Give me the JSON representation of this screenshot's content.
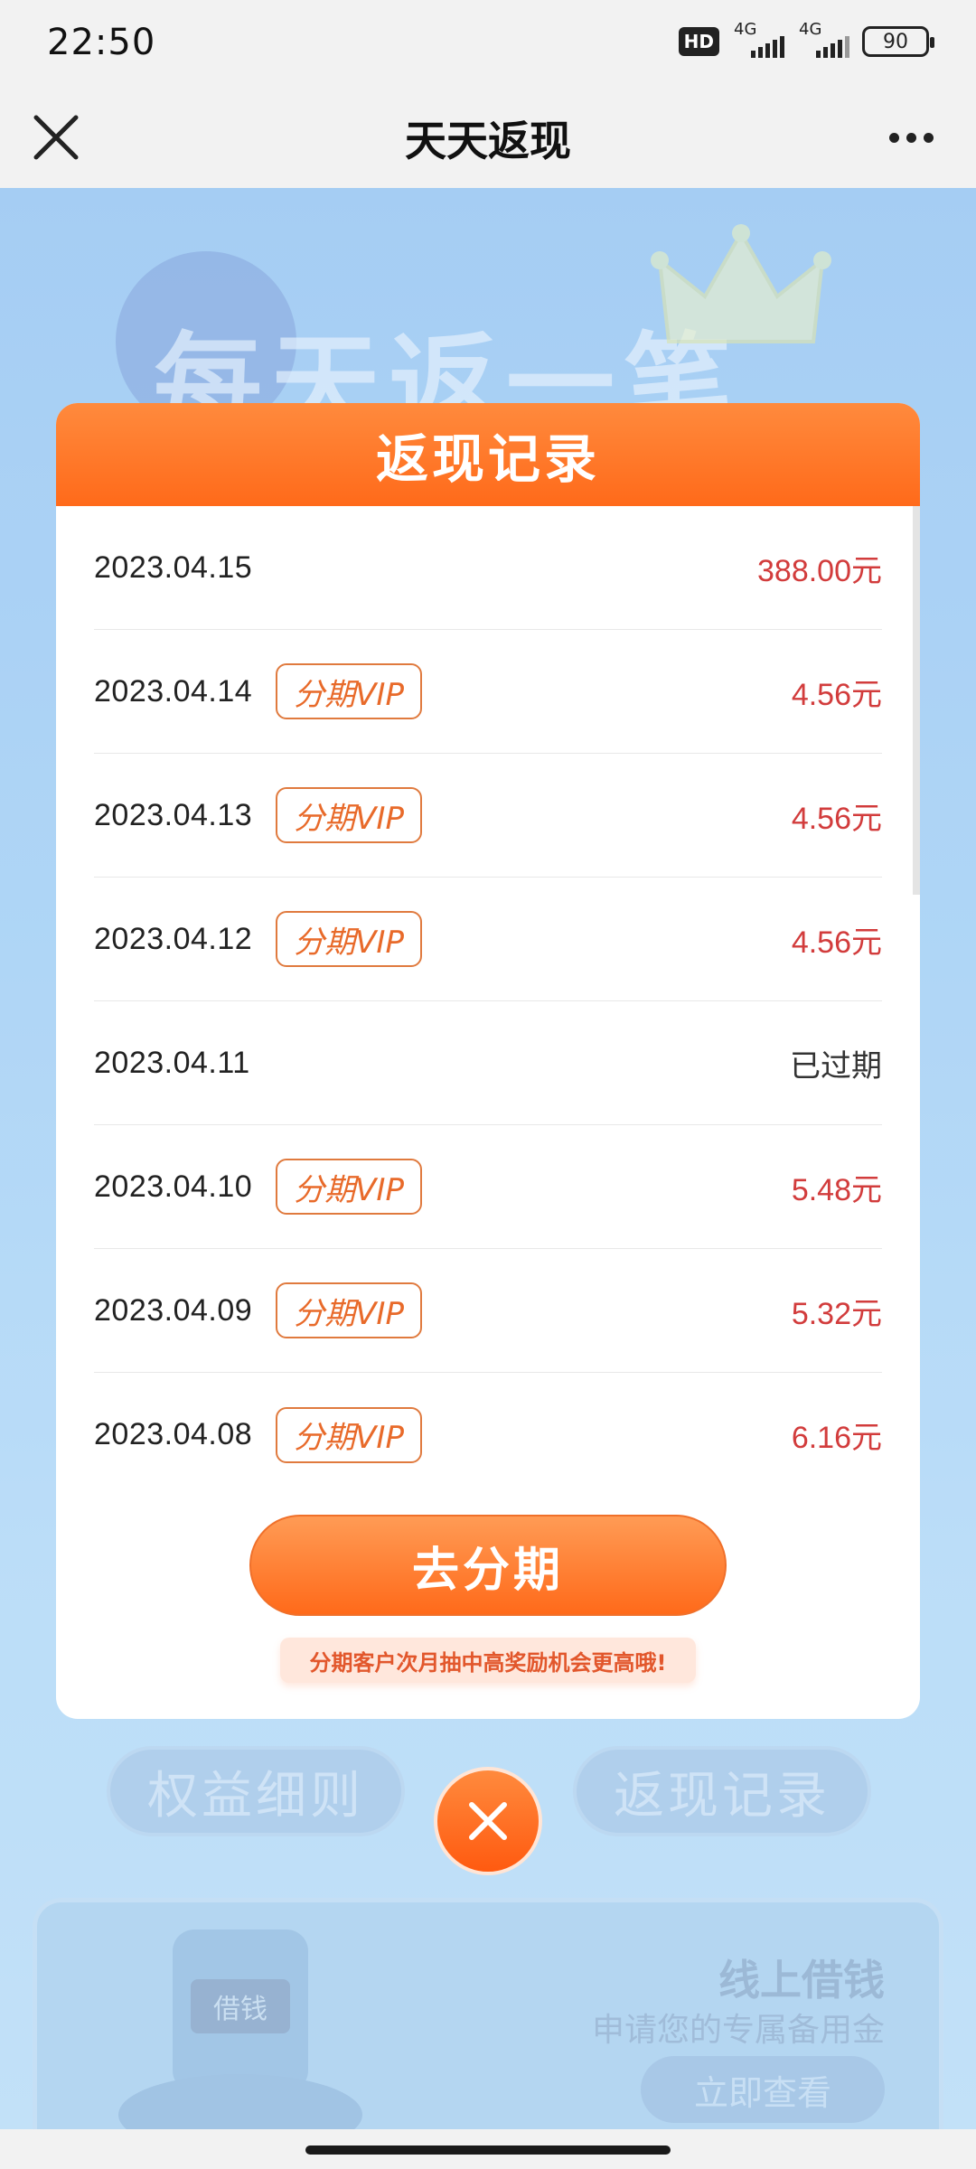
{
  "status_bar": {
    "time": "22:50",
    "hd": "HD",
    "net1": "4G",
    "net2": "4G",
    "battery": "90"
  },
  "nav": {
    "title": "天天返现"
  },
  "background": {
    "headline": "每天返一笔",
    "pill_left": "权益细则",
    "pill_right": "返现记录",
    "card_title": "线上借钱",
    "card_subtitle": "申请您的专属备用金",
    "card_button": "立即查看",
    "phone_label": "借钱"
  },
  "modal": {
    "title": "返现记录",
    "rows": [
      {
        "date": "2023.04.15",
        "tag": "",
        "amount": "388.00元"
      },
      {
        "date": "2023.04.14",
        "tag": "分期VIP",
        "amount": "4.56元"
      },
      {
        "date": "2023.04.13",
        "tag": "分期VIP",
        "amount": "4.56元"
      },
      {
        "date": "2023.04.12",
        "tag": "分期VIP",
        "amount": "4.56元"
      },
      {
        "date": "2023.04.11",
        "tag": "",
        "amount": "已过期"
      },
      {
        "date": "2023.04.10",
        "tag": "分期VIP",
        "amount": "5.48元"
      },
      {
        "date": "2023.04.09",
        "tag": "分期VIP",
        "amount": "5.32元"
      },
      {
        "date": "2023.04.08",
        "tag": "分期VIP",
        "amount": "6.16元"
      }
    ],
    "button": "去分期",
    "tip": "分期客户次月抽中高奖励机会更高哦!"
  },
  "colors": {
    "accent": "#ff6a1a",
    "amount": "#d23c3c"
  },
  "icons": {
    "close_nav": "close-icon",
    "more": "more-icon",
    "close_modal": "close-icon"
  }
}
